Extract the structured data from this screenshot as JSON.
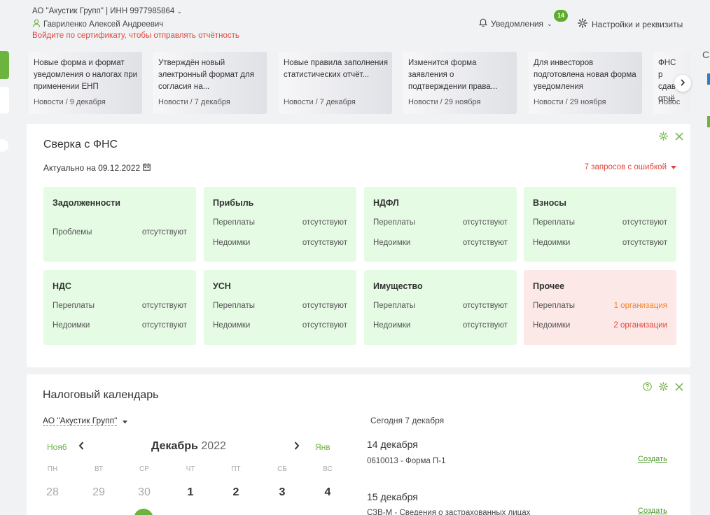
{
  "header": {
    "org": "АО \"Акустик Групп\" | ИНН 9977985864",
    "person": "Гавриленко Алексей Андреевич",
    "warning": "Войдите по сертификату, чтобы отправлять отчётность",
    "notifications_label": "Уведомления",
    "notifications_count": "14",
    "settings_label": "Настройки и реквизиты"
  },
  "right_edge_letter": "С",
  "news": [
    {
      "title": "Новые форма и формат уведомления о налогах при применении ЕНП",
      "meta": "Новости / 9 декабря"
    },
    {
      "title": "Утверждён новый электронный формат для согласия на...",
      "meta": "Новости / 7 декабря"
    },
    {
      "title": "Новые правила заполнения статистических отчёт...",
      "meta": "Новости / 7 декабря"
    },
    {
      "title": "Изменится форма заявления о подтверждении права...",
      "meta": "Новости / 29 ноября"
    },
    {
      "title": "Для инвесторов подготовлена новая форма уведомления",
      "meta": "Новости / 29 ноября"
    },
    {
      "title": "ФНС р сдав отчё",
      "meta": "Новос"
    }
  ],
  "reconciliation": {
    "title": "Сверка с ФНС",
    "actual": "Актуально на 09.12.2022",
    "errors": "7 запросов с ошибкой",
    "tiles": [
      {
        "name": "Задолженности",
        "rows": [
          {
            "label": "Проблемы",
            "value": "отсутствуют"
          }
        ]
      },
      {
        "name": "Прибыль",
        "rows": [
          {
            "label": "Переплаты",
            "value": "отсутствуют"
          },
          {
            "label": "Недоимки",
            "value": "отсутствуют"
          }
        ]
      },
      {
        "name": "НДФЛ",
        "rows": [
          {
            "label": "Переплаты",
            "value": "отсутствуют"
          },
          {
            "label": "Недоимки",
            "value": "отсутствуют"
          }
        ]
      },
      {
        "name": "Взносы",
        "rows": [
          {
            "label": "Переплаты",
            "value": "отсутствуют"
          },
          {
            "label": "Недоимки",
            "value": "отсутствуют"
          }
        ]
      },
      {
        "name": "НДС",
        "rows": [
          {
            "label": "Переплаты",
            "value": "отсутствуют"
          },
          {
            "label": "Недоимки",
            "value": "отсутствуют"
          }
        ]
      },
      {
        "name": "УСН",
        "rows": [
          {
            "label": "Переплаты",
            "value": "отсутствуют"
          },
          {
            "label": "Недоимки",
            "value": "отсутствуют"
          }
        ]
      },
      {
        "name": "Имущество",
        "rows": [
          {
            "label": "Переплаты",
            "value": "отсутствуют"
          },
          {
            "label": "Недоимки",
            "value": "отсутствуют"
          }
        ]
      },
      {
        "name": "Прочее",
        "rows": [
          {
            "label": "Переплаты",
            "value": "1 организация"
          },
          {
            "label": "Недоимки",
            "value": "2 организации"
          }
        ]
      }
    ]
  },
  "calendar": {
    "title": "Налоговый календарь",
    "org": "АО \"Акустик Групп\"",
    "prev_month": "Ноя6",
    "month": "Декабрь",
    "year": "2022",
    "next_month": "Янв",
    "weekdays": [
      "ПН",
      "ВТ",
      "СР",
      "ЧТ",
      "ПТ",
      "СБ",
      "ВС"
    ],
    "days": [
      "28",
      "29",
      "30",
      "1",
      "2",
      "3",
      "4"
    ],
    "today_label": "Сегодня 7 декабря",
    "events": [
      {
        "date": "14 декабря",
        "name": "0610013 - Форма П-1",
        "action": "Создать"
      },
      {
        "date": "15 декабря",
        "name": "СЗВ-М - Сведения о застрахованных лицах",
        "action": "Создать"
      }
    ]
  },
  "colors": {
    "accent_green": "#6cb33f",
    "error_red": "#e0483d",
    "tile_green": "#e5fbe4",
    "tile_red": "#fde8e8",
    "warning_orange": "#f0862f"
  }
}
